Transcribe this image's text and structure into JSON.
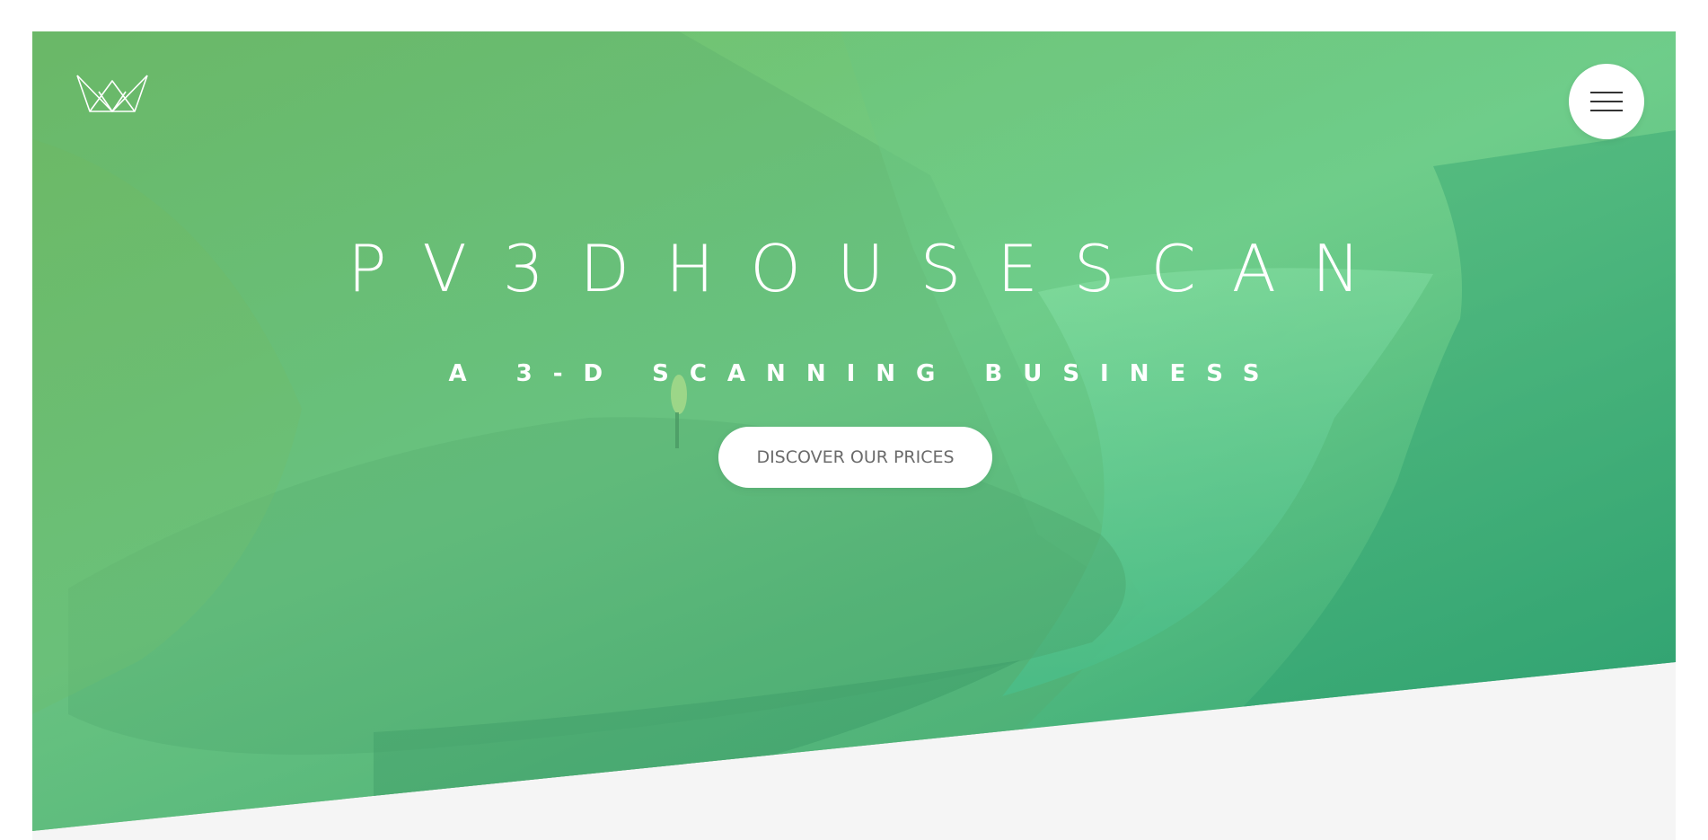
{
  "header": {
    "logo_icon": "crown-icon",
    "menu_icon": "hamburger-menu-icon"
  },
  "hero": {
    "title": "PV3DHOUSESCAN",
    "subtitle": "A 3-D SCANNING BUSINESS",
    "cta_label": "DISCOVER OUR PRICES"
  },
  "colors": {
    "accent_green": "#5cc98a",
    "tint_light": "#7fd690",
    "tint_dark": "#2ea878",
    "page_background": "#f5f5f5",
    "button_bg": "#ffffff",
    "button_text": "#6b6b6b"
  }
}
